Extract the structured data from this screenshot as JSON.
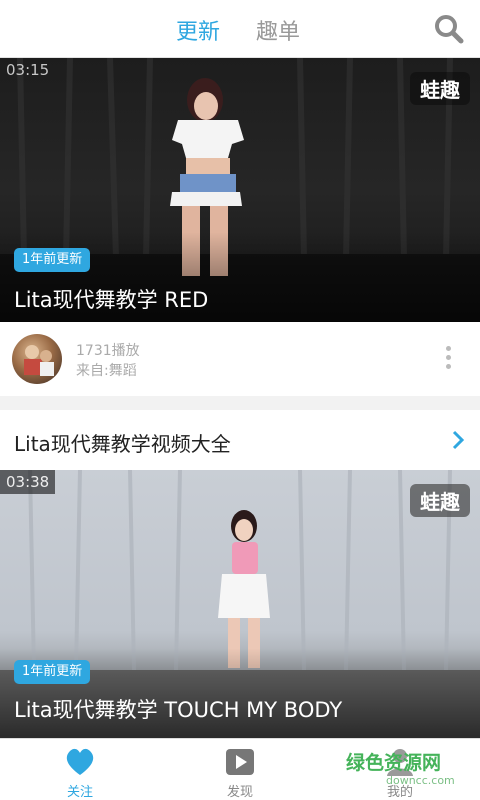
{
  "header": {
    "tabs": [
      {
        "label": "更新",
        "active": true
      },
      {
        "label": "趣单",
        "active": false
      }
    ],
    "search_icon": "search-icon"
  },
  "feed": {
    "video1": {
      "duration": "03:15",
      "brand": "蛙趣",
      "badge": "1年前更新",
      "title": "Lita现代舞教学 RED"
    },
    "meta": {
      "plays": "1731播放",
      "source": "来自:舞蹈",
      "more_icon": "more-vertical-icon"
    },
    "section": {
      "title": "Lita现代舞教学视频大全",
      "chevron_icon": "chevron-right-icon"
    },
    "video2": {
      "duration": "03:38",
      "brand": "蛙趣",
      "badge": "1年前更新",
      "title": "Lita现代舞教学 TOUCH MY BODY"
    }
  },
  "bottom_nav": {
    "items": [
      {
        "label": "关注",
        "icon": "heart-icon",
        "active": true
      },
      {
        "label": "发现",
        "icon": "play-icon",
        "active": false
      },
      {
        "label": "我的",
        "icon": "user-icon",
        "active": false
      }
    ]
  },
  "watermark": {
    "text": "绿色资源网",
    "url": "downcc.com"
  },
  "colors": {
    "accent": "#2fa7e0",
    "watermark": "#45b35a"
  }
}
